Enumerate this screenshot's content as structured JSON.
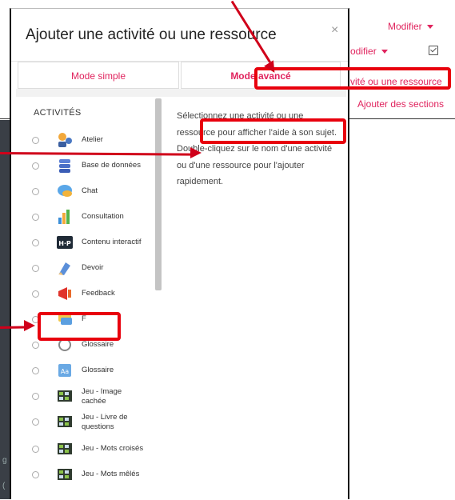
{
  "background": {
    "modifier_top": "Modifier",
    "modifier_second": "odifier",
    "add_activity_link": "vité ou une ressource",
    "add_sections_link": "Ajouter des sections",
    "strip_text_1": "g",
    "strip_text_2": "(",
    "accent_color": "#e0245e"
  },
  "modal": {
    "title": "Ajouter une activité ou une ressource",
    "close_label": "×",
    "tabs": [
      "Mode simple",
      "Mode avancé"
    ],
    "section_title": "ACTIVITÉS",
    "help_text": "Sélectionnez une activité ou une ressource pour afficher l'aide à son sujet. Double-cliquez sur le nom d'une activité ou d'une ressource pour l'ajouter rapidement.",
    "activities": [
      {
        "label": "Atelier",
        "icon": "workshop-icon"
      },
      {
        "label": "Base de données",
        "icon": "database-icon"
      },
      {
        "label": "Chat",
        "icon": "chat-icon"
      },
      {
        "label": "Consultation",
        "icon": "poll-chart-icon"
      },
      {
        "label": "Contenu interactif",
        "icon": "h5p-icon"
      },
      {
        "label": "Devoir",
        "icon": "assignment-icon"
      },
      {
        "label": "Feedback",
        "icon": "megaphone-icon"
      },
      {
        "label": "F",
        "icon": "forum-icon"
      },
      {
        "label": "Glossaire",
        "icon": "glossary-icon"
      },
      {
        "label": "Glossaire",
        "icon": "glossary-book-icon"
      },
      {
        "label": "Jeu - Image cachée",
        "icon": "game-icon"
      },
      {
        "label": "Jeu - Livre de questions",
        "icon": "game-icon"
      },
      {
        "label": "Jeu - Mots croisés",
        "icon": "game-icon"
      },
      {
        "label": "Jeu - Mots mêlés",
        "icon": "game-icon"
      }
    ]
  },
  "annotation_color": "#e8000d"
}
